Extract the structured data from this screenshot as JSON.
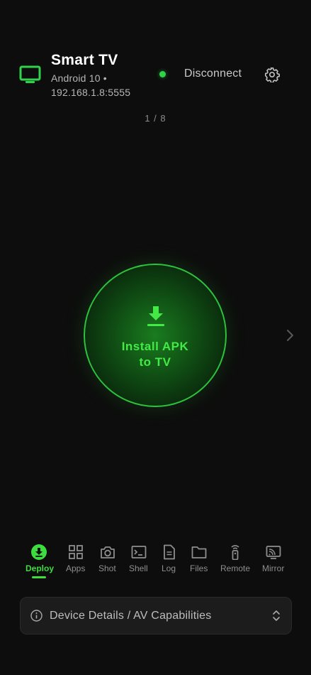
{
  "device": {
    "name": "Smart TV",
    "os": "Android 10 •",
    "address": "192.168.1.8:5555",
    "status_color": "#2fd24a",
    "icon": "tv-icon"
  },
  "header": {
    "disconnect_label": "Disconnect",
    "settings_icon": "gear-icon"
  },
  "pager": {
    "text": "1 / 8"
  },
  "primary_action": {
    "label_line1": "Install APK",
    "label_line2": "to TV",
    "icon": "download-icon",
    "accent": "#43ea46"
  },
  "tabs": [
    {
      "label": "Deploy",
      "icon": "download-circle-icon",
      "active": true
    },
    {
      "label": "Apps",
      "icon": "grid-icon",
      "active": false
    },
    {
      "label": "Shot",
      "icon": "camera-icon",
      "active": false
    },
    {
      "label": "Shell",
      "icon": "terminal-icon",
      "active": false
    },
    {
      "label": "Log",
      "icon": "document-icon",
      "active": false
    },
    {
      "label": "Files",
      "icon": "folder-icon",
      "active": false
    },
    {
      "label": "Remote",
      "icon": "remote-icon",
      "active": false
    },
    {
      "label": "Mirror",
      "icon": "cast-icon",
      "active": false
    }
  ],
  "details_panel": {
    "label": "Device Details / AV Capabilities",
    "icon": "info-icon",
    "toggle_icon": "chevron-up-down-icon"
  }
}
